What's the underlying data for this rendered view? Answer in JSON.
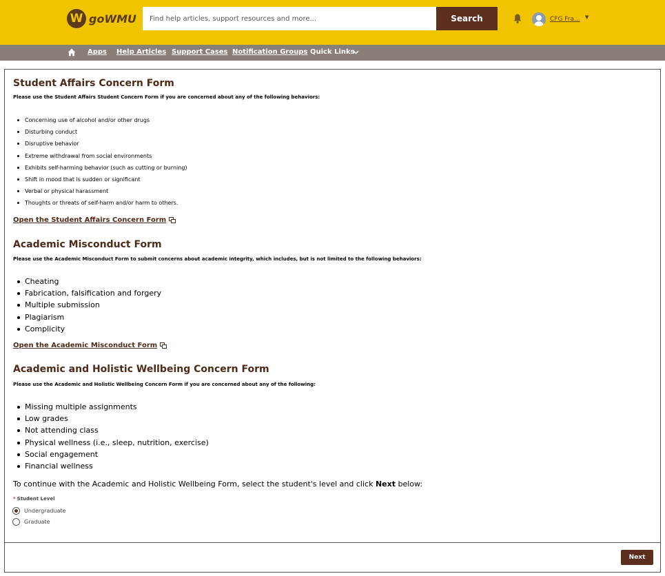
{
  "header": {
    "logo_mark": "W",
    "logo_text": "goWMU",
    "search_placeholder": "Find help articles, support resources and more...",
    "search_button": "Search",
    "user_name": "CFG Fra...",
    "brand_color": "#f1c400",
    "accent_color": "#5c2e1e"
  },
  "nav": {
    "home_icon": "home-icon",
    "links": [
      "Apps",
      "Help Articles",
      "Support Cases",
      "Notification Groups"
    ],
    "quick_links": "Quick Links"
  },
  "sections": [
    {
      "title": "Student Affairs Concern Form",
      "intro": "Please use the Student Affairs Student Concern Form if you are concerned about any of the following behaviors:",
      "items": [
        "Concerning use of alcohol and/or other drugs",
        "Disturbing conduct",
        "Disruptive behavior",
        "Extreme withdrawal from social environments",
        "Exhibits self-harming behavior (such as cutting or burning)",
        "Shift in mood that is sudden or significant",
        "Verbal or physical harassment",
        "Thoughts or threats of self-harm and/or harm to others."
      ],
      "link": "Open the Student Affairs Concern Form"
    },
    {
      "title": "Academic Misconduct Form",
      "intro": "Please use the Academic Misconduct Form to submit concerns about academic integrity, which includes, but is not limited to the following behaviors:",
      "items": [
        "Cheating",
        "Fabrication, falsification and forgery",
        "Multiple submission",
        "Plagiarism",
        "Complicity"
      ],
      "link": "Open the Academic Misconduct Form"
    },
    {
      "title": "Academic and Holistic Wellbeing Concern Form",
      "intro": "Please use the Academic and Holistic Wellbeing Concern Form if you are concerned about any of the following:",
      "items": [
        "Missing multiple assignments",
        "Low grades",
        "Not attending class",
        "Physical wellness (i.e., sleep, nutrition, exercise)",
        "Social engagement",
        "Financial wellness"
      ]
    }
  ],
  "continue_text": {
    "before": "To continue with the Academic and Holistic Wellbeing Form, select the student's level and click ",
    "bold": "Next",
    "after": " below:"
  },
  "student_level": {
    "required_mark": "*",
    "label": "Student Level",
    "options": [
      "Undergraduate",
      "Graduate"
    ],
    "selected": "Undergraduate"
  },
  "next_button": "Next"
}
